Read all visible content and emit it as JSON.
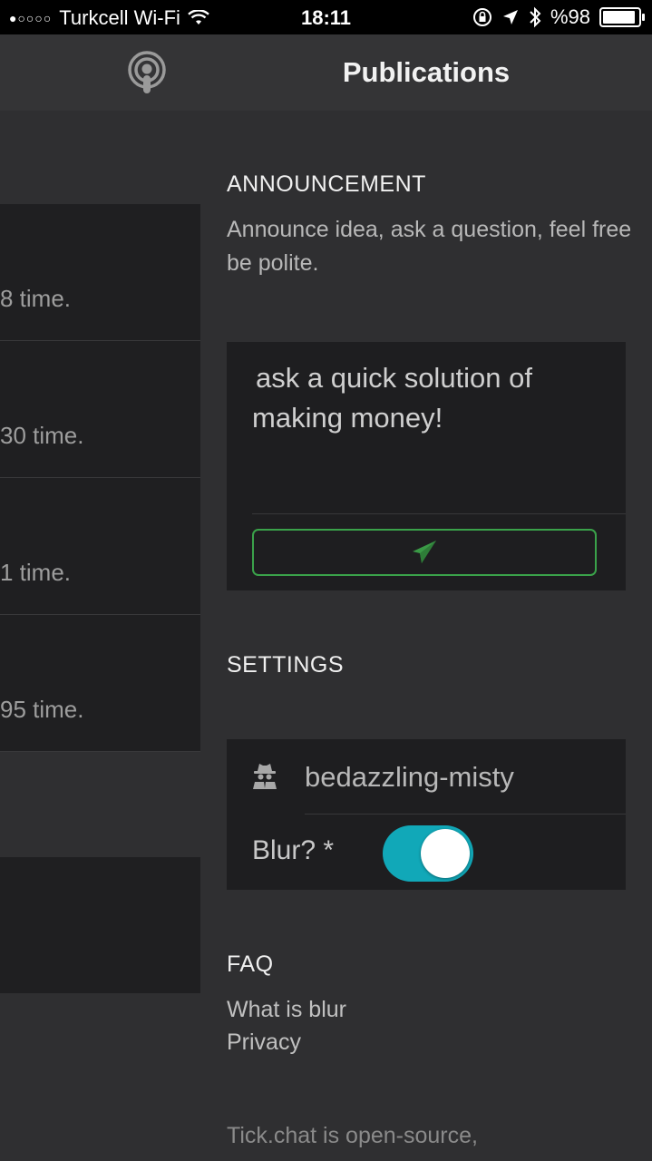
{
  "status_bar": {
    "signal_dots": "●○○○○",
    "carrier": "Turkcell Wi-Fi",
    "time": "18:11",
    "battery": "%98",
    "battery_level": 0.98,
    "icons": [
      "wifi-icon",
      "rotation-lock-icon",
      "location-arrow-icon",
      "bluetooth-icon",
      "battery-icon"
    ]
  },
  "navbar": {
    "icon": "podcast-icon",
    "title": "Publications"
  },
  "left_list": {
    "items": [
      {
        "text": "8 time."
      },
      {
        "text": "30 time."
      },
      {
        "text": "1 time."
      },
      {
        "text": "95 time."
      }
    ]
  },
  "announcement": {
    "heading": "ANNOUNCEMENT",
    "description": "Announce idea, ask a question, feel free be polite.",
    "message": "ask a quick solution of making money!",
    "send_icon": "paper-plane-icon",
    "accent_color": "#3aa24a"
  },
  "settings": {
    "heading": "SETTINGS",
    "user_icon": "spy-icon",
    "username": "bedazzling-misty",
    "blur_label": "Blur? *",
    "blur_enabled": true,
    "toggle_color": "#11a8b8"
  },
  "faq": {
    "heading": "FAQ",
    "links": [
      "What is blur",
      "Privacy"
    ]
  },
  "footer": {
    "text": "Tick.chat is open-source,"
  }
}
